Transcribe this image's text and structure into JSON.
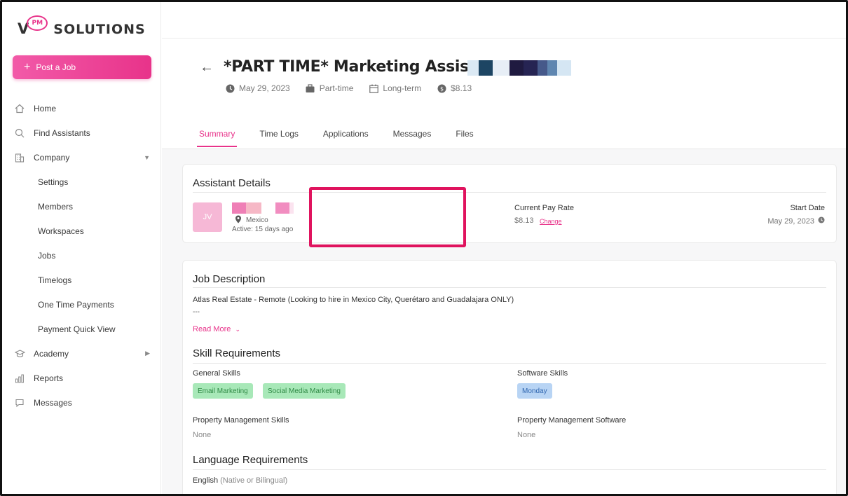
{
  "logo": {
    "v": "V",
    "pm": "PM",
    "solutions": "SOLUTIONS"
  },
  "post_job_label": "Post a Job",
  "nav": {
    "home": "Home",
    "find_assistants": "Find Assistants",
    "company": "Company",
    "settings": "Settings",
    "members": "Members",
    "workspaces": "Workspaces",
    "jobs": "Jobs",
    "timelogs": "Timelogs",
    "one_time_payments": "One Time Payments",
    "payment_quick_view": "Payment Quick View",
    "academy": "Academy",
    "reports": "Reports",
    "messages": "Messages"
  },
  "job": {
    "title": "*PART TIME* Marketing Assistant",
    "date": "May 29, 2023",
    "type": "Part-time",
    "term": "Long-term",
    "rate": "$8.13"
  },
  "tabs": [
    "Summary",
    "Time Logs",
    "Applications",
    "Messages",
    "Files"
  ],
  "assistant_details": {
    "heading": "Assistant Details",
    "initials": "JV",
    "location": "Mexico",
    "active": "Active: 15 days ago",
    "pay_label": "Current Pay Rate",
    "pay_value": "$8.13",
    "change": "Change",
    "start_label": "Start Date",
    "start_value": "May 29, 2023"
  },
  "job_description": {
    "heading": "Job Description",
    "text": "Atlas Real Estate - Remote (Looking to hire in Mexico City, Querétaro and Guadalajara ONLY)",
    "dash": "---",
    "read_more": "Read More"
  },
  "skills": {
    "heading": "Skill Requirements",
    "general_label": "General Skills",
    "general_tags": [
      "Email Marketing",
      "Social Media Marketing"
    ],
    "software_label": "Software Skills",
    "software_tags": [
      "Monday"
    ],
    "pm_skills_label": "Property Management Skills",
    "pm_skills_value": "None",
    "pm_software_label": "Property Management Software",
    "pm_software_value": "None"
  },
  "language": {
    "heading": "Language Requirements",
    "language": "English",
    "level": "(Native or Bilingual)"
  },
  "colors": {
    "accent": "#e8338a",
    "highlight": "#e0135e"
  }
}
